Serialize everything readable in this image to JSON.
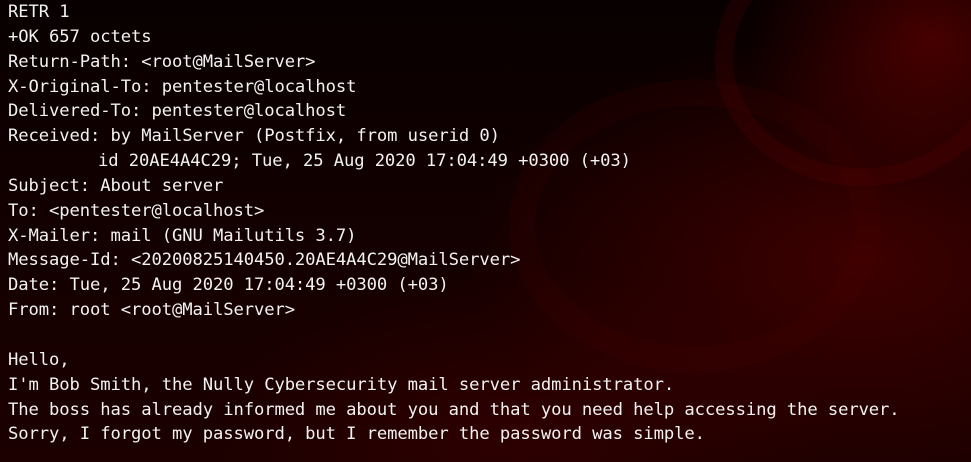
{
  "terminal": {
    "lines": [
      "RETR 1",
      "+OK 657 octets",
      "Return-Path: <root@MailServer>",
      "X-Original-To: pentester@localhost",
      "Delivered-To: pentester@localhost",
      "Received: by MailServer (Postfix, from userid 0)",
      "id 20AE4A4C29; Tue, 25 Aug 2020 17:04:49 +0300 (+03)",
      "Subject: About server",
      "To: <pentester@localhost>",
      "X-Mailer: mail (GNU Mailutils 3.7)",
      "Message-Id: <20200825140450.20AE4A4C29@MailServer>",
      "Date: Tue, 25 Aug 2020 17:04:49 +0300 (+03)",
      "From: root <root@MailServer>",
      "",
      "Hello,",
      "I'm Bob Smith, the Nully Cybersecurity mail server administrator.",
      "The boss has already informed me about you and that you need help accessing the server.",
      "Sorry, I forgot my password, but I remember the password was simple."
    ]
  }
}
